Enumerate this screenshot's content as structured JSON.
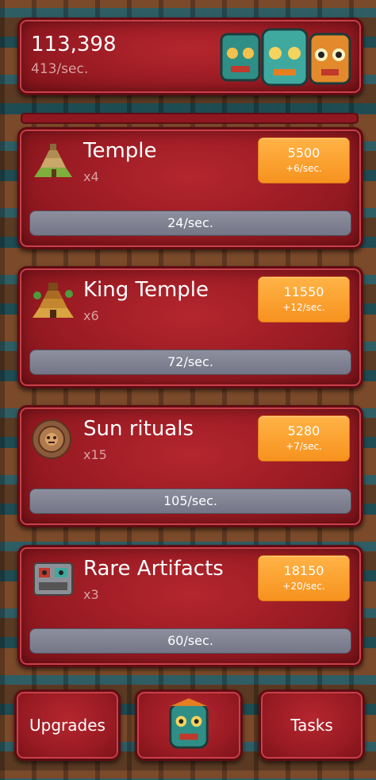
{
  "header": {
    "total": "113,398",
    "rate": "413/sec."
  },
  "buildings": [
    {
      "name": "Temple",
      "count": "x4",
      "price": "5500",
      "increment": "+6/sec.",
      "production": "24/sec.",
      "icon": "temple-icon"
    },
    {
      "name": "King Temple",
      "count": "x6",
      "price": "11550",
      "increment": "+12/sec.",
      "production": "72/sec.",
      "icon": "king-temple-icon"
    },
    {
      "name": "Sun rituals",
      "count": "x15",
      "price": "5280",
      "increment": "+7/sec.",
      "production": "105/sec.",
      "icon": "sun-stone-icon"
    },
    {
      "name": "Rare Artifacts",
      "count": "x3",
      "price": "18150",
      "increment": "+20/sec.",
      "production": "60/sec.",
      "icon": "artifact-icon"
    }
  ],
  "nav": {
    "upgrades": "Upgrades",
    "tasks": "Tasks",
    "center_icon": "mask-icon"
  },
  "colors": {
    "panel": "#9a1b23",
    "buy_button": "#f7921e",
    "bar": "#7f8091"
  }
}
